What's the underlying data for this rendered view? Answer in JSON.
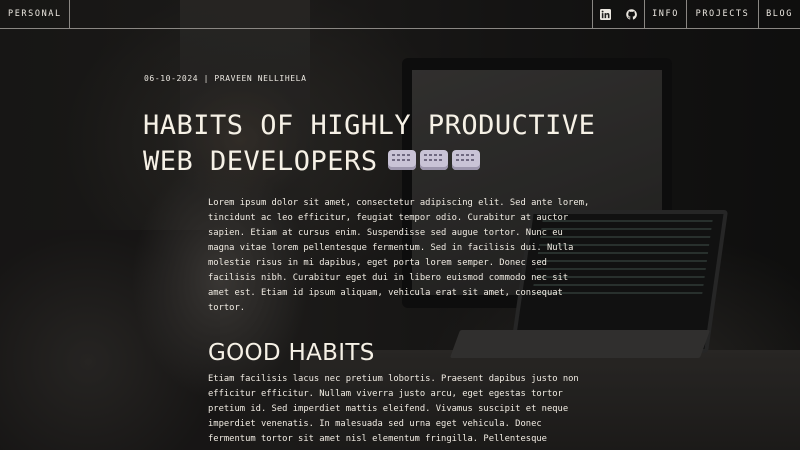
{
  "nav": {
    "brand": "PERSONAL",
    "icons": [
      "linkedin-icon",
      "github-icon"
    ],
    "links": [
      "INFO",
      "PROJECTS",
      "BLOG"
    ]
  },
  "article": {
    "meta": "06-10-2024 | PRAVEEN NELLIHELA",
    "title_line1": "HABITS OF HIGHLY PRODUCTIVE",
    "title_line2": "WEB DEVELOPERS",
    "title_emoji": [
      "keyboard-icon",
      "keyboard-icon",
      "keyboard-icon"
    ],
    "intro": "Lorem ipsum dolor sit amet, consectetur adipiscing elit. Sed ante lorem, tincidunt ac leo efficitur, feugiat tempor odio. Curabitur at auctor sapien. Etiam at cursus enim. Suspendisse sed augue tortor. Nunc eu magna vitae lorem pellentesque fermentum. Sed in facilisis dui. Nulla molestie risus in mi dapibus, eget porta lorem semper. Donec sed facilisis nibh. Curabitur eget dui in libero euismod commodo nec sit amet est. Etiam id ipsum aliquam, vehicula erat sit amet, consequat tortor.",
    "section_heading": "GOOD HABITS",
    "section_text": "Etiam facilisis lacus nec pretium lobortis. Praesent dapibus justo non efficitur efficitur. Nullam viverra justo arcu, eget egestas tortor pretium id. Sed imperdiet mattis eleifend. Vivamus suscipit et neque imperdiet venenatis. In malesuada sed urna eget vehicula. Donec fermentum tortor sit amet nisl elementum fringilla. Pellentesque"
  }
}
